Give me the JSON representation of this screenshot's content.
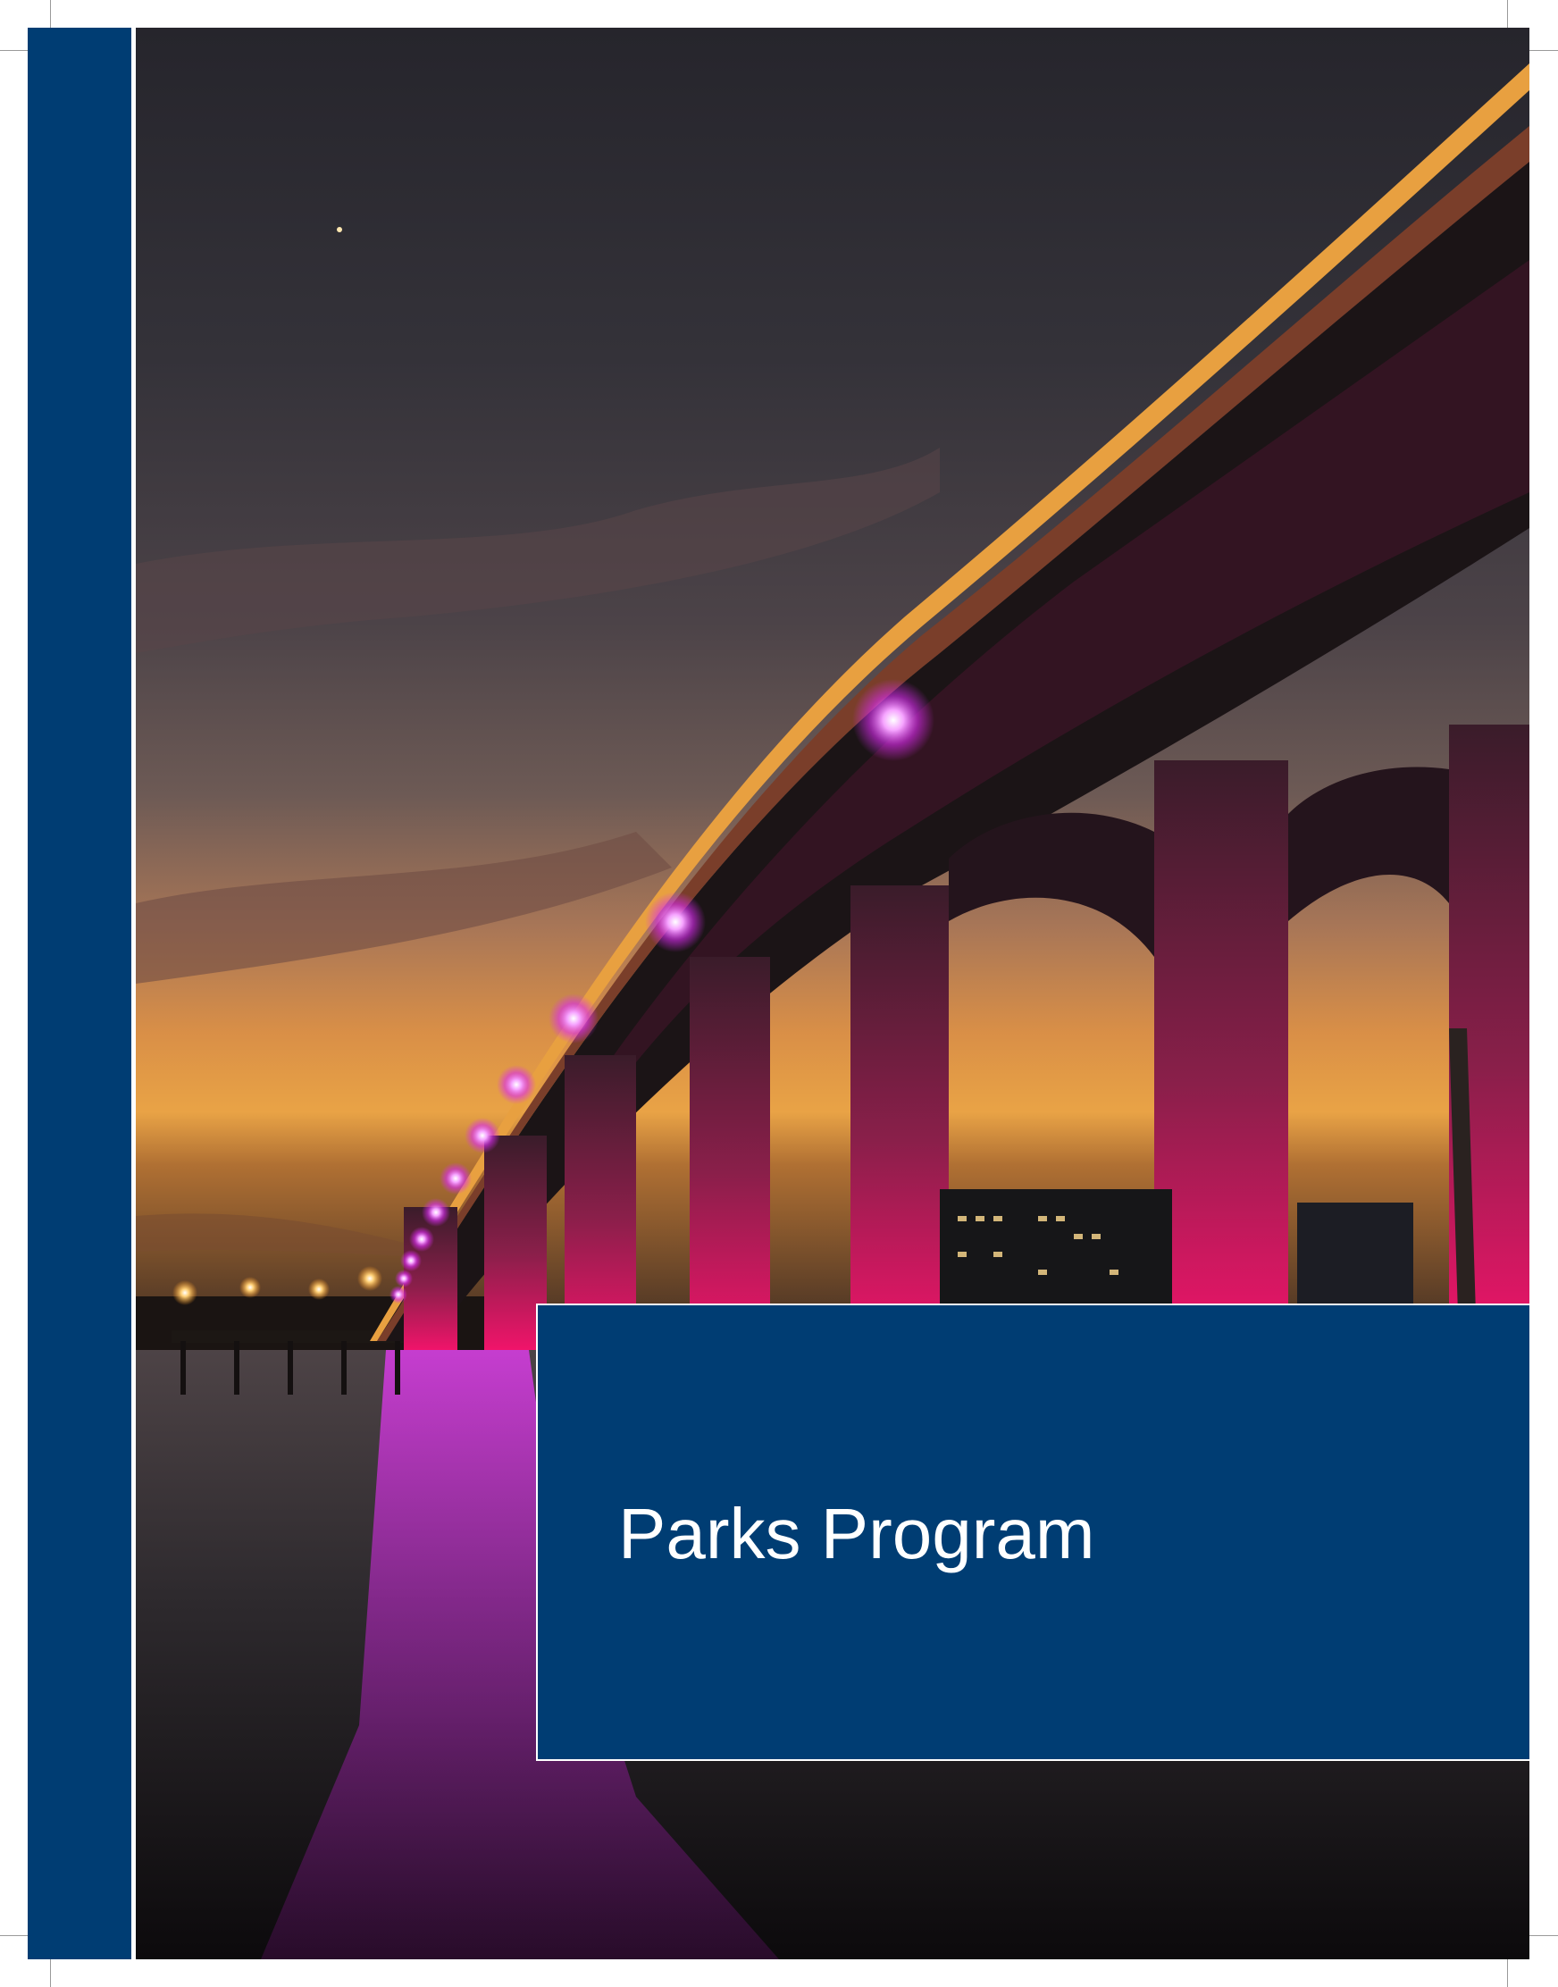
{
  "cover": {
    "title": "Parks Program",
    "photo_subject": "bridge-at-dusk-image",
    "accent_color": "#003d73",
    "bridge_light_color": "#e43cff"
  }
}
